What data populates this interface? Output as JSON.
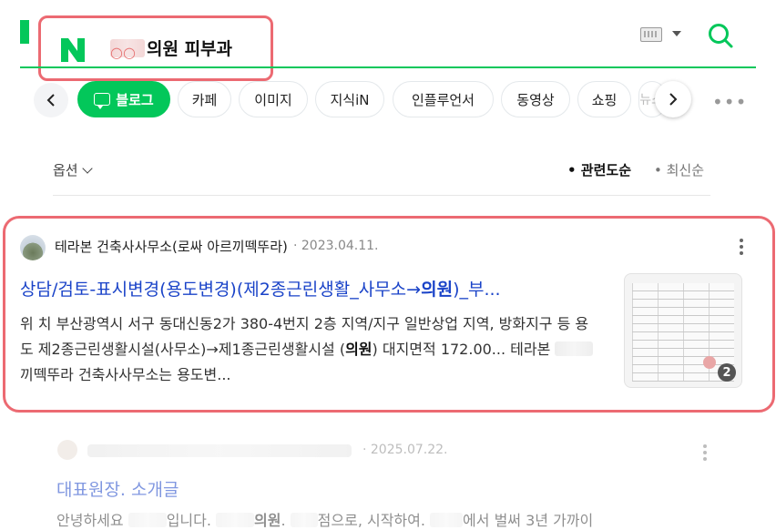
{
  "header": {
    "query_masked_prefix": "○○",
    "query_text": "의원 피부과",
    "colors": {
      "brand": "#03c75a",
      "highlight": "#ec6a72",
      "link": "#1a43c8"
    }
  },
  "tabs": [
    {
      "label": "블로그",
      "active": true
    },
    {
      "label": "카페"
    },
    {
      "label": "이미지"
    },
    {
      "label": "지식iN"
    },
    {
      "label": "인플루언서"
    },
    {
      "label": "동영상"
    },
    {
      "label": "쇼핑"
    },
    {
      "label": "뉴스"
    }
  ],
  "filter": {
    "options_label": "옵션",
    "sort_relevance": "• 관련도순",
    "sort_latest": "• 최신순"
  },
  "results": [
    {
      "author": "테라본 건축사사무소(로싸 아르끼떽뚜라)",
      "date": "· 2023.04.11.",
      "title_pre": "상담/검토-표시변경(용도변경)(제2종근린생활_사무소→",
      "title_bold": "의원",
      "title_post": ")_부...",
      "snippet_1": "위 치 부산광역시 서구 동대신동2가 380-4번지 2층 지역/지구 일반상업 지역, 방화지구 등 용 도 제2종근린생활시설(사무소)→제1종근린생활시설 (",
      "snippet_bold": "의원",
      "snippet_2": ") 대지면적 172.00... 테라본 ",
      "snippet_3": "끼떽뚜라 건축사사무소는 용도변...",
      "image_count": "2"
    },
    {
      "date": "· 2025.07.22.",
      "title": "대표원장. 소개글",
      "snippet_a": "안녕하세요 ",
      "snippet_b": "입니다. ",
      "snippet_bold": "의원",
      "snippet_c": ". ",
      "snippet_d": "점으로, 시작하여. ",
      "snippet_e": "에서 벌써 3년 가까이"
    }
  ]
}
